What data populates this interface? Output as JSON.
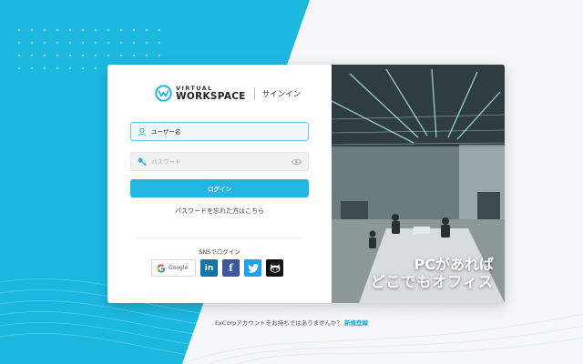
{
  "brand": {
    "line1": "VIRTUAL",
    "line2": "WORKSPACE",
    "signin_label": "サインイン"
  },
  "form": {
    "username_placeholder": "ユーザー名",
    "password_placeholder": "パスワード",
    "login_label": "ログイン",
    "forgot_label": "パスワードを忘れた方はこちら"
  },
  "sns": {
    "title": "SNSでログイン",
    "google_label": "Google",
    "linkedin_label": "in",
    "facebook_label": "f"
  },
  "hero": {
    "line1": "PCがあれば",
    "line2": "どこでもオフィス"
  },
  "footer": {
    "text": "ExCorpアカウントをお持ちではありませんか？",
    "link": "新規登録"
  },
  "icons": {
    "brand_logo": "w-circle-logo-icon",
    "username": "user-icon",
    "password": "key-icon",
    "reveal": "eye-icon",
    "google": "google-icon",
    "linkedin": "linkedin-icon",
    "facebook": "facebook-icon",
    "twitter": "twitter-icon",
    "github": "github-icon"
  },
  "colors": {
    "accent": "#21b7e2",
    "background_cyan": "#1cb8e0",
    "link": "#1aa5d6"
  }
}
